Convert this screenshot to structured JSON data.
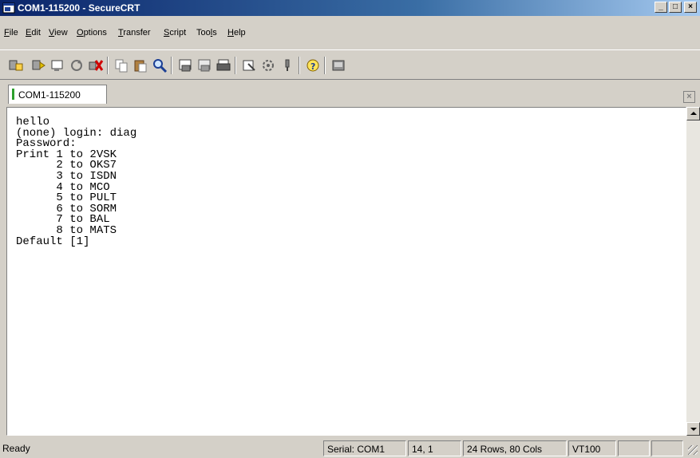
{
  "window": {
    "title": "COM1-115200 - SecureCRT",
    "controls": {
      "minimize": "_",
      "maximize": "□",
      "close": "×"
    }
  },
  "menu": [
    "File",
    "Edit",
    "View",
    "Options",
    "Transfer",
    "Script",
    "Tools",
    "Help"
  ],
  "menu_mnemonics": [
    "F",
    "E",
    "V",
    "O",
    "T",
    "S",
    "l",
    "H"
  ],
  "toolbar": {
    "icons": [
      "connect-icon",
      "quick-connect-icon",
      "connect-tab-icon",
      "reconnect-icon",
      "disconnect-icon",
      "copy-icon",
      "paste-icon",
      "find-icon",
      "print-icon",
      "print-selection-icon",
      "print-screen-icon",
      "session-options-icon",
      "global-options-icon",
      "keymap-icon",
      "help-icon",
      "sftp-icon"
    ]
  },
  "tab": {
    "label": "COM1-115200",
    "accent": "#2ca02c"
  },
  "terminal": {
    "lines": [
      "hello",
      "(none) login: diag",
      "Password:",
      "Print 1 to 2VSK",
      "      2 to OKS7",
      "      3 to ISDN",
      "      4 to MCO",
      "      5 to PULT",
      "      6 to SORM",
      "      7 to BAL",
      "      8 to MATS",
      "Default [1]"
    ]
  },
  "status": {
    "ready": "Ready",
    "serial": "Serial: COM1",
    "cursor": "14,  1",
    "size": "24 Rows, 80 Cols",
    "emulation": "VT100",
    "extra1": "",
    "extra2": ""
  }
}
